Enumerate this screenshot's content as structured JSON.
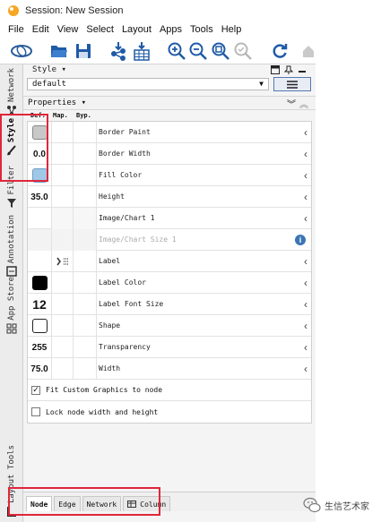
{
  "window": {
    "title": "Session: New Session"
  },
  "menu": [
    "File",
    "Edit",
    "View",
    "Select",
    "Layout",
    "Apps",
    "Tools",
    "Help"
  ],
  "left_tabs": [
    "Network",
    "Style",
    "Filter",
    "Annotation",
    "App Store",
    "Layout Tools"
  ],
  "style_panel": {
    "header_label": "Style ▾",
    "selected_style": "default",
    "properties_label": "Properties ▾",
    "columns": [
      "Def.",
      "Map.",
      "Byp."
    ]
  },
  "properties": [
    {
      "name": "Border Paint",
      "def": "",
      "def_type": "swatch",
      "color": "#c8c8c8"
    },
    {
      "name": "Border Width",
      "def": "0.0",
      "def_type": "number"
    },
    {
      "name": "Fill Color",
      "def": "",
      "def_type": "swatch",
      "color": "#9fc8e8"
    },
    {
      "name": "Height",
      "def": "35.0",
      "def_type": "number"
    },
    {
      "name": "Image/Chart 1",
      "def": "",
      "def_type": "empty"
    },
    {
      "name": "Image/Chart Size 1",
      "def": "",
      "def_type": "disabled"
    },
    {
      "name": "Label",
      "def": "",
      "def_type": "label-icon"
    },
    {
      "name": "Label Color",
      "def": "",
      "def_type": "swatch",
      "color": "#000000"
    },
    {
      "name": "Label Font Size",
      "def": "12",
      "def_type": "bignumber"
    },
    {
      "name": "Shape",
      "def": "",
      "def_type": "shape"
    },
    {
      "name": "Transparency",
      "def": "255",
      "def_type": "number"
    },
    {
      "name": "Width",
      "def": "75.0",
      "def_type": "number"
    }
  ],
  "options": [
    {
      "label": "Fit Custom Graphics to node",
      "checked": true,
      "mark": "✓"
    },
    {
      "label": "Lock node width and height",
      "checked": false,
      "mark": ""
    }
  ],
  "bottom_tabs": [
    "Node",
    "Edge",
    "Network",
    "Column"
  ],
  "watermark": {
    "text": "生信艺术家"
  },
  "colors": {
    "highlight": "#e0263a",
    "accent": "#3b75b5"
  }
}
